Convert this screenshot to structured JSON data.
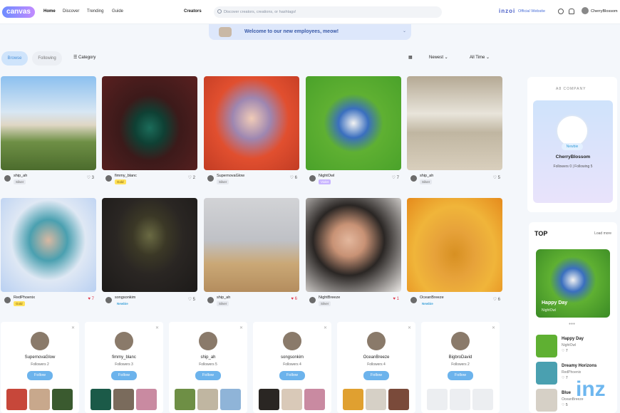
{
  "header": {
    "logo": "canvas",
    "nav": [
      "Home",
      "Discover",
      "Trending",
      "Guide"
    ],
    "filter": "Creators",
    "search_placeholder": "Discover creators, creations, or hashtags!",
    "brand": "inzoi",
    "brand_site": "Official Website",
    "username": "CherryBlossom"
  },
  "banner": {
    "text": "Welcome to our new employees, meow!"
  },
  "controls": {
    "browse": "Browse",
    "following": "Following",
    "category": "Category",
    "sort": "Newest",
    "time": "All Time"
  },
  "feed": [
    {
      "user": "ship_ah",
      "badge": "Silver",
      "likes": "3"
    },
    {
      "user": "fimmy_blanc",
      "badge": "Gold",
      "likes": "2"
    },
    {
      "user": "SupernovaGlow",
      "badge": "Silver",
      "likes": "6"
    },
    {
      "user": "NightOwl",
      "badge": "Violet",
      "likes": "7"
    },
    {
      "user": "ship_ah",
      "badge": "Silver",
      "likes": "5"
    },
    {
      "user": "RedPhoenix",
      "badge": "Gold",
      "likes": "7"
    },
    {
      "user": "songsonkim",
      "badge": "Newbie",
      "likes": "5"
    },
    {
      "user": "ship_ah",
      "badge": "Silver",
      "likes": "6"
    },
    {
      "user": "NightBreeze",
      "badge": "Silver",
      "likes": "1"
    },
    {
      "user": "OceanBreeze",
      "badge": "Newbie",
      "likes": "6"
    }
  ],
  "suggestions": [
    {
      "name": "SupernovaGlow",
      "followers": "Followers 2"
    },
    {
      "name": "fimmy_blanc",
      "followers": "Followers 3"
    },
    {
      "name": "ship_ah",
      "followers": "Followers 5"
    },
    {
      "name": "songsonkim",
      "followers": "Followers 4"
    },
    {
      "name": "OceanBreeze",
      "followers": "Followers 4"
    },
    {
      "name": "BigbroDavid",
      "followers": "Followers 2"
    }
  ],
  "follow_label": "Follow",
  "profile": {
    "company": "A8 COMPANY",
    "name": "CherryBlossom",
    "badge": "Newbie",
    "stats": "Followers 0 | Following 5"
  },
  "top": {
    "title": "TOP",
    "more": "Load more",
    "featured": {
      "title": "Happy Day",
      "user": "NightOwl"
    },
    "list": [
      {
        "title": "Happy Day",
        "user": "NightOwl",
        "likes": "7"
      },
      {
        "title": "Dreamy Horizons",
        "user": "RedPhoenix",
        "likes": "7"
      },
      {
        "title": "Blue",
        "user": "OceanBreeze",
        "likes": "5"
      }
    ]
  },
  "watermark": "inz",
  "colors": {
    "accent": "#6cb3ec",
    "brand": "#4a5fc8",
    "gold_badge": "#ffe15a",
    "violet_badge": "#c9b5ff",
    "newbie": "#3aa0d8"
  }
}
